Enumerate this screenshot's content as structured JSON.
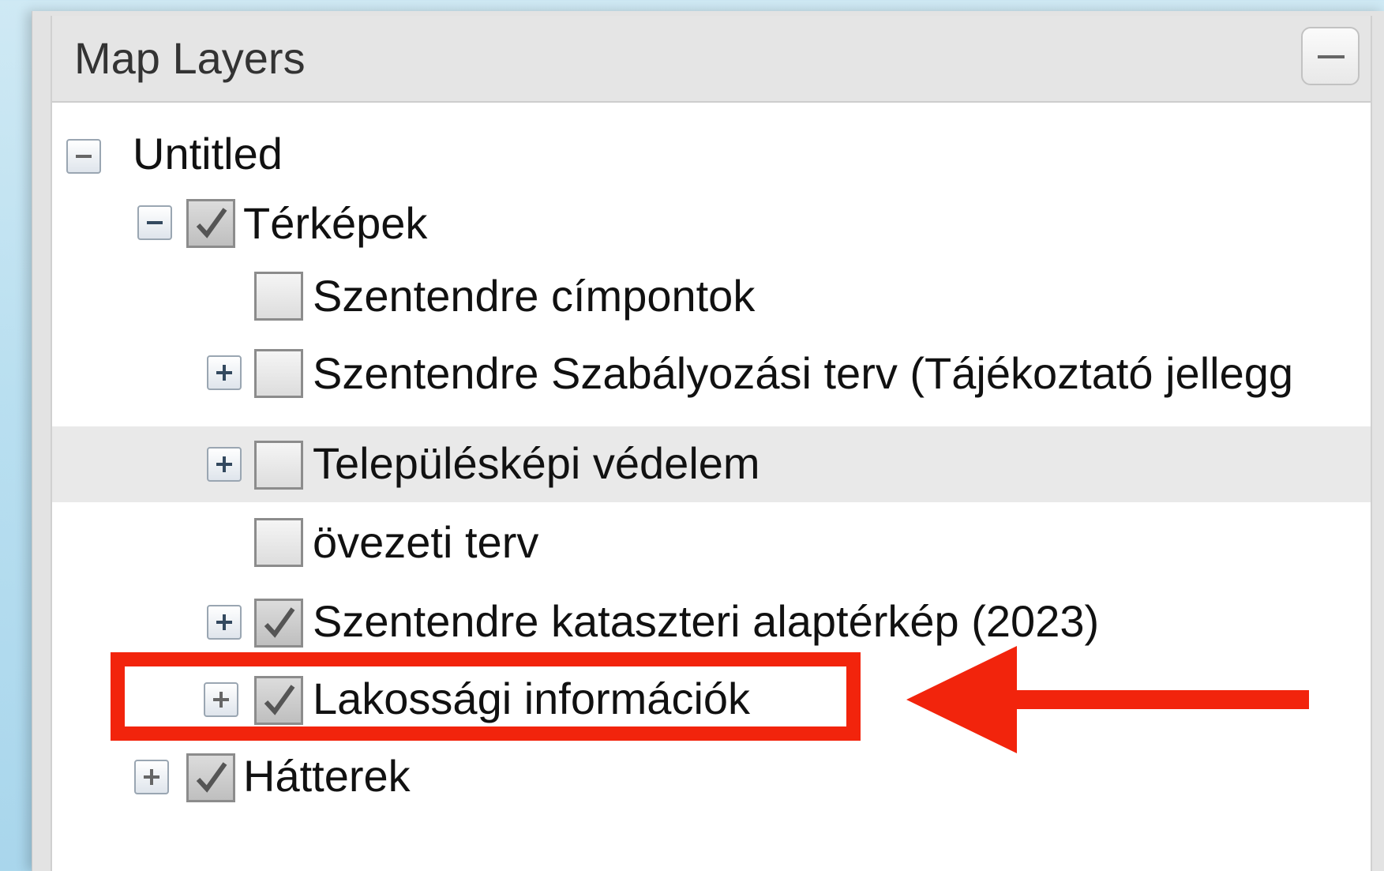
{
  "panel": {
    "title": "Map Layers"
  },
  "tree": {
    "root": {
      "label": "Untitled",
      "expanded": true
    },
    "items": [
      {
        "label": "Térképek",
        "checked": true,
        "expanded": true,
        "level": 1
      },
      {
        "label": "Szentendre címpontok",
        "checked": false,
        "level": 2
      },
      {
        "label": "Szentendre Szabályozási terv (Tájékoztató jellegg",
        "checked": false,
        "expandable": true,
        "level": 2
      },
      {
        "label": "Településképi védelem",
        "checked": false,
        "expandable": true,
        "level": 2,
        "highlighted": true
      },
      {
        "label": "övezeti terv",
        "checked": false,
        "level": 2
      },
      {
        "label": "Szentendre kataszteri alaptérkép (2023)",
        "checked": true,
        "expandable": true,
        "level": 2
      },
      {
        "label": "Lakossági információk",
        "checked": true,
        "expandable": true,
        "level": 2,
        "annotated": true
      },
      {
        "label": "Hátterek",
        "checked": true,
        "expandable": true,
        "level": 1
      }
    ]
  },
  "annotation": {
    "color": "#f2240c"
  }
}
